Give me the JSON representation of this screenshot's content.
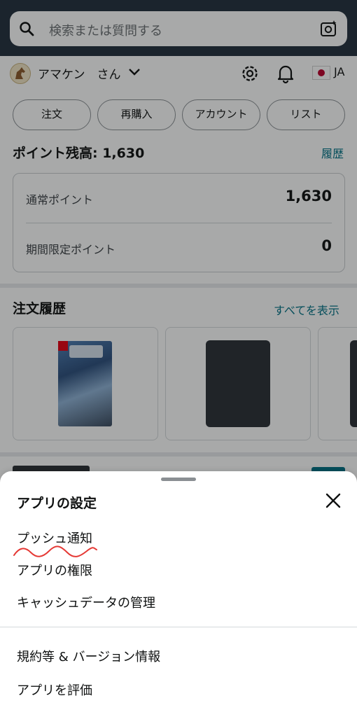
{
  "search": {
    "placeholder": "検索または質問する"
  },
  "user": {
    "name": "アマケン　さん",
    "language": "JA"
  },
  "pills": [
    "注文",
    "再購入",
    "アカウント",
    "リスト"
  ],
  "points": {
    "title": "ポイント残高: 1,630",
    "history_link": "履歴",
    "rows": [
      {
        "label": "通常ポイント",
        "value": "1,630"
      },
      {
        "label": "期間限定ポイント",
        "value": "0"
      }
    ]
  },
  "orders": {
    "title": "注文履歴",
    "view_all": "すべてを表示"
  },
  "sheet": {
    "title": "アプリの設定",
    "items": [
      "プッシュ通知",
      "アプリの権限",
      "キャッシュデータの管理"
    ],
    "items2": [
      "規約等 & バージョン情報",
      "アプリを評価"
    ]
  },
  "colors": {
    "header": "#232f3e",
    "link": "#007185",
    "annotation": "#e53935"
  },
  "icons": [
    "search-icon",
    "camera-search-icon",
    "chevron-down-icon",
    "gear-icon",
    "bell-icon",
    "japan-flag-icon",
    "close-icon"
  ]
}
